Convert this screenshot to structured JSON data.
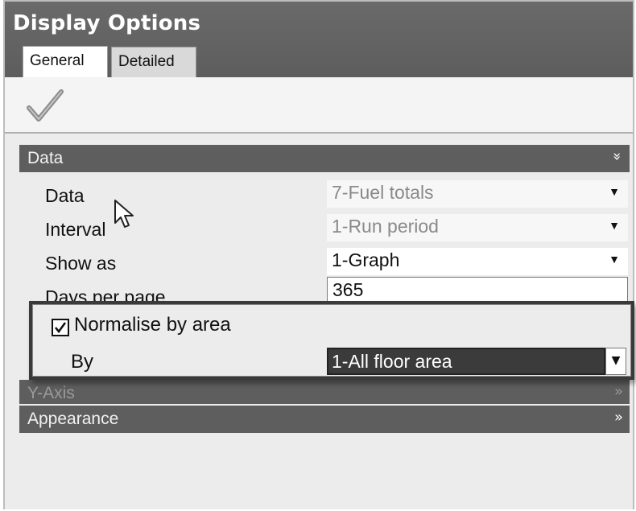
{
  "window": {
    "title": "Display Options"
  },
  "tabs": [
    {
      "label": "General",
      "active": true
    },
    {
      "label": "Detailed",
      "active": false
    }
  ],
  "toolbar": {
    "apply_icon": "checkmark-icon"
  },
  "sections": {
    "data": {
      "header": "Data",
      "toggle_icon": "double-chevron-down-icon",
      "rows": {
        "data": {
          "label": "Data",
          "value": "7-Fuel totals"
        },
        "interval": {
          "label": "Interval",
          "value": "1-Run period"
        },
        "show_as": {
          "label": "Show as",
          "value": "1-Graph"
        },
        "days_per_page": {
          "label": "Days per page",
          "value": "365"
        }
      },
      "normalise": {
        "label": "Normalise by area",
        "checked": true
      },
      "by": {
        "label": "By",
        "value": "1-All floor area"
      }
    },
    "y_axis": {
      "header": "Y-Axis",
      "toggle_icon": "double-chevron-right-icon"
    },
    "appearance": {
      "header": "Appearance",
      "toggle_icon": "double-chevron-right-icon"
    }
  },
  "icons": {
    "dropdown": "▾",
    "chev_down": "»",
    "chev_right": "»"
  }
}
